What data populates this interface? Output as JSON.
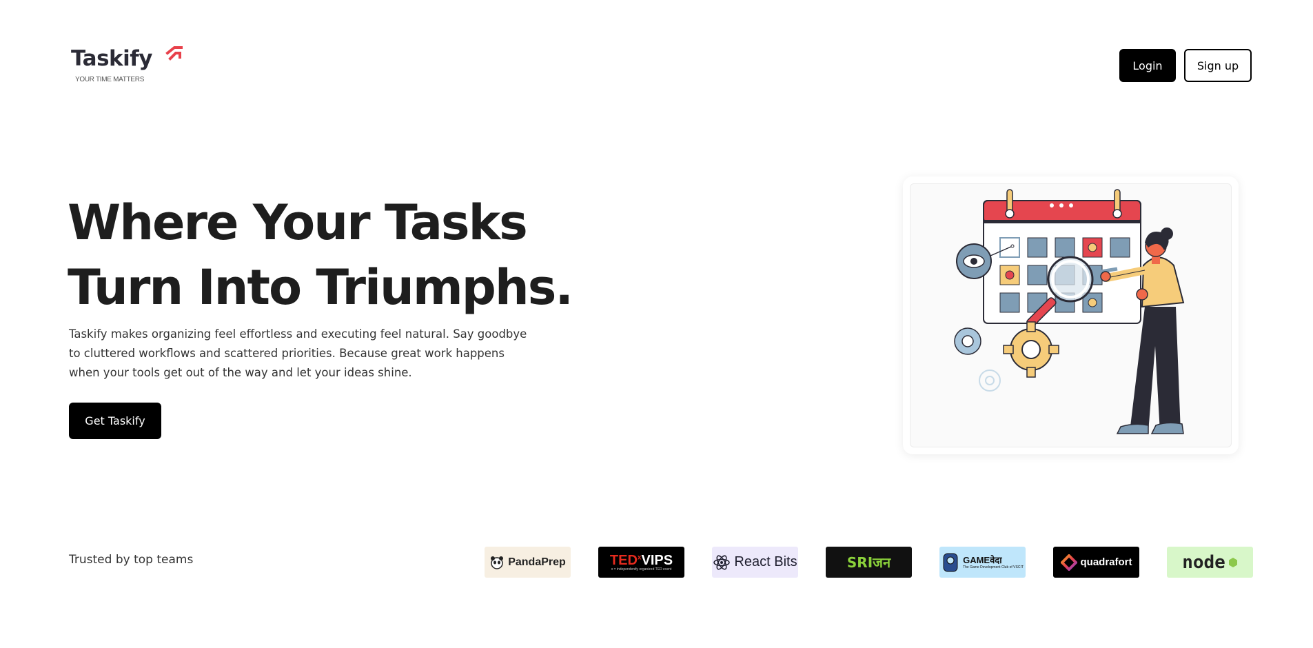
{
  "header": {
    "logo_text": "Taskify",
    "logo_tagline": "YOUR TIME MATTERS",
    "login_label": "Login",
    "signup_label": "Sign up"
  },
  "hero": {
    "title_line1": "Where Your Tasks",
    "title_line2": "Turn Into Triumphs.",
    "description": "Taskify makes organizing feel effortless and executing feel natural. Say goodbye to cluttered workflows and scattered priorities. Because great work happens when your tools get out of the way and let your ideas shine.",
    "cta_label": "Get Taskify"
  },
  "trusted": {
    "label": "Trusted by top teams",
    "logos": [
      {
        "name": "PandaPrep",
        "text": "PandaPrep"
      },
      {
        "name": "TEDxVIPS",
        "text_red": "TED",
        "text_x": "x",
        "text_white": "VIPS",
        "sub": "x = independently organized TED event"
      },
      {
        "name": "React Bits",
        "text": "React Bits"
      },
      {
        "name": "Srijan",
        "text": "SRIजन"
      },
      {
        "name": "GameVeda",
        "text": "GAMEवेदा",
        "sub": "The Game Development Club of VSCIT"
      },
      {
        "name": "quadrafort",
        "text": "quadrafort"
      },
      {
        "name": "Node.js",
        "text": "node"
      }
    ]
  },
  "colors": {
    "accent_red": "#e8414b",
    "button_black": "#000000",
    "calendar_blue": "#7f9db5",
    "calendar_yellow": "#f6cc7a"
  }
}
